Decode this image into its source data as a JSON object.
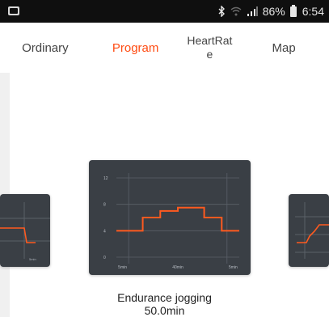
{
  "status_bar": {
    "battery_percent": "86%",
    "time": "6:54",
    "icons": [
      "photo-icon",
      "bluetooth-icon",
      "wifi-icon",
      "signal-icon",
      "battery-icon"
    ]
  },
  "tabs": [
    {
      "label": "Ordinary",
      "active": false
    },
    {
      "label": "Program",
      "active": true
    },
    {
      "label": "HeartRate",
      "active": false
    },
    {
      "label": "Map",
      "active": false
    }
  ],
  "colors": {
    "accent": "#ff4b12",
    "card_bg": "#3a3f45",
    "curve": "#ff5a1f"
  },
  "program": {
    "name": "Endurance jogging",
    "duration": "50.0min",
    "chart_data": {
      "type": "line",
      "y_ticks": [
        "12",
        "8",
        "4",
        "0"
      ],
      "x_labels": [
        "5min",
        "40min",
        "5min"
      ],
      "segments_min": [
        5,
        40,
        5
      ],
      "profile": [
        4,
        4,
        4,
        6,
        6,
        7,
        7,
        7.5,
        7.5,
        7.5,
        6,
        6,
        4,
        4
      ],
      "ylim": [
        0,
        12
      ]
    }
  }
}
